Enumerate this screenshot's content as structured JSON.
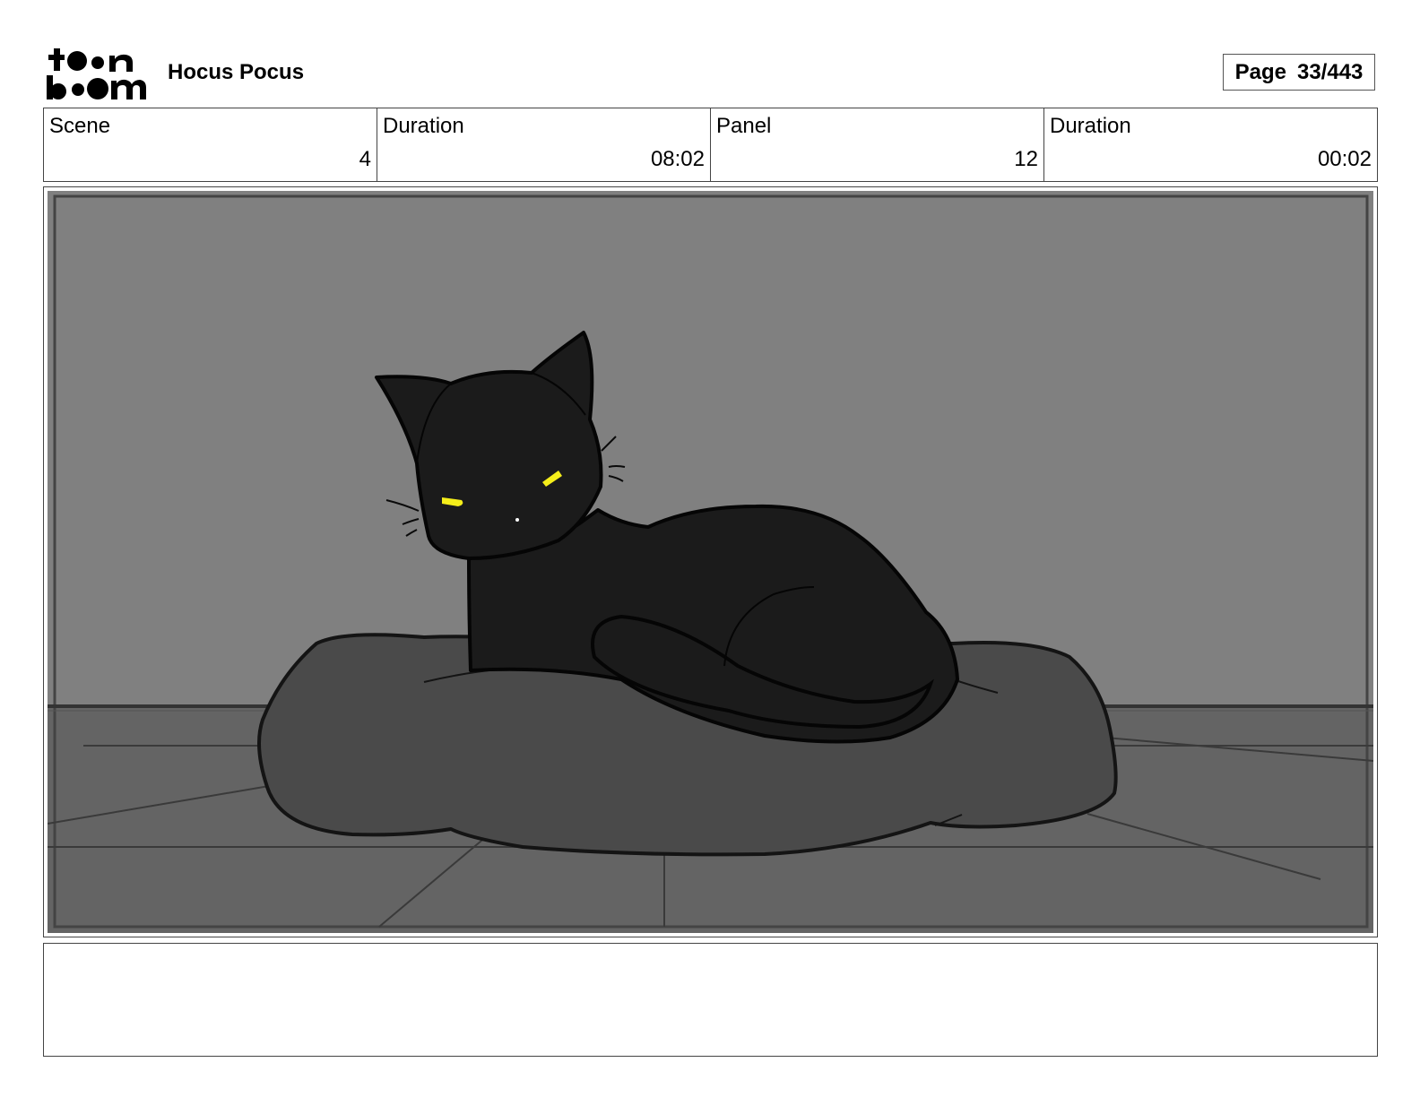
{
  "header": {
    "logo_text": "toon boom",
    "project_title": "Hocus Pocus",
    "page_label": "Page",
    "page_number": "33/443"
  },
  "info": {
    "scene_label": "Scene",
    "scene_value": "4",
    "scene_duration_label": "Duration",
    "scene_duration_value": "08:02",
    "panel_label": "Panel",
    "panel_value": "12",
    "panel_duration_label": "Duration",
    "panel_duration_value": "00:02"
  },
  "panel": {
    "colors": {
      "wall": "#808080",
      "floor": "#646464",
      "cushion": "#4a4a4a",
      "cat": "#1b1b1b",
      "eyes": "#f5ee1a"
    }
  },
  "notes": {
    "text": ""
  }
}
